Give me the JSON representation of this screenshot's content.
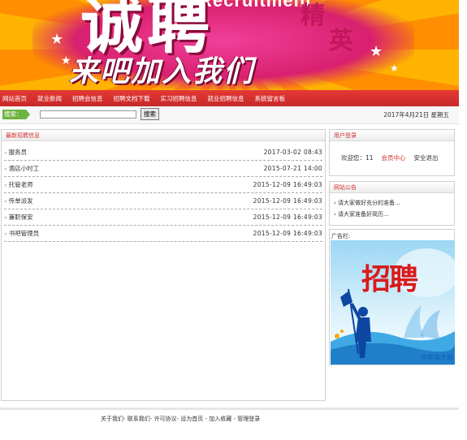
{
  "banner": {
    "main_word": "诚聘",
    "side_word1": "精",
    "side_word2": "英",
    "english": "Recruitment",
    "slogan": "来吧加入我们"
  },
  "nav": {
    "items": [
      "网站首页",
      "就业新闻",
      "招聘会信息",
      "招聘文档下载",
      "实习招聘信息",
      "就业招聘信息",
      "系统留言板"
    ]
  },
  "search": {
    "label": "搜索：",
    "value": "",
    "button_label": "搜索"
  },
  "date_text": "2017年4月21日 星期五",
  "jobs": {
    "title": "最新招聘信息",
    "items": [
      {
        "title": "服务员",
        "time": "2017-03-02 08:43"
      },
      {
        "title": "酒店小时工",
        "time": "2015-07-21 14:00"
      },
      {
        "title": "托管老师",
        "time": "2015-12-09 16:49:03"
      },
      {
        "title": "传单派发",
        "time": "2015-12-09 16:49:03"
      },
      {
        "title": "兼职保安",
        "time": "2015-12-09 16:49:03"
      },
      {
        "title": "书吧管理员",
        "time": "2015-12-09 16:49:03"
      }
    ]
  },
  "user_login": {
    "title": "用户登录",
    "welcome": "欢迎您：11",
    "member_center": "会员中心",
    "logout": "安全退出"
  },
  "notice": {
    "title": "网站公告",
    "items": [
      "请大家做好充分的准备...",
      "请大家准备好简历..."
    ]
  },
  "ad": {
    "title": "广告栏:",
    "image_word": "招聘",
    "logo_text": "中华英才网"
  },
  "footer": {
    "links": [
      "关于我们",
      "联系我们",
      "许可协议",
      "设为首页",
      "加入收藏",
      "管理登录"
    ]
  },
  "colors": {
    "nav_red": "#d32f2f",
    "accent_green": "#6db33f",
    "banner_orange": "#ffb300",
    "banner_pink": "#d9206f"
  }
}
